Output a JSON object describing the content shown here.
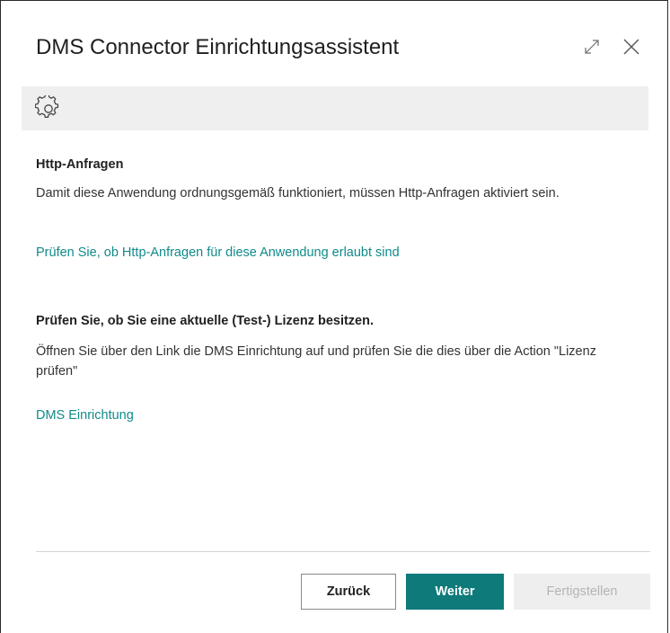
{
  "dialog": {
    "title": "DMS Connector Einrichtungsassistent",
    "icons": {
      "expand": "expand-icon",
      "close": "close-icon",
      "settings": "gear-icon"
    }
  },
  "sections": [
    {
      "heading": "Http-Anfragen",
      "text": "Damit diese Anwendung ordnungsgemäß funktioniert, müssen Http-Anfragen aktiviert sein.",
      "link": "Prüfen Sie, ob Http-Anfragen für diese Anwendung erlaubt sind"
    },
    {
      "heading": "Prüfen Sie, ob Sie eine aktuelle (Test-) Lizenz besitzen.",
      "text": "Öffnen Sie über den Link die DMS Einrichtung auf und prüfen Sie die dies über die Action \"Lizenz prüfen\"",
      "link": "DMS Einrichtung"
    }
  ],
  "footer": {
    "back_label": "Zurück",
    "next_label": "Weiter",
    "finish_label": "Fertigstellen",
    "finish_disabled": true
  },
  "colors": {
    "accent": "#0e7a7a",
    "link": "#118a8a",
    "toolbar_bg": "#efefef",
    "disabled_bg": "#eeeeee",
    "disabled_text": "#b4b4b4"
  }
}
